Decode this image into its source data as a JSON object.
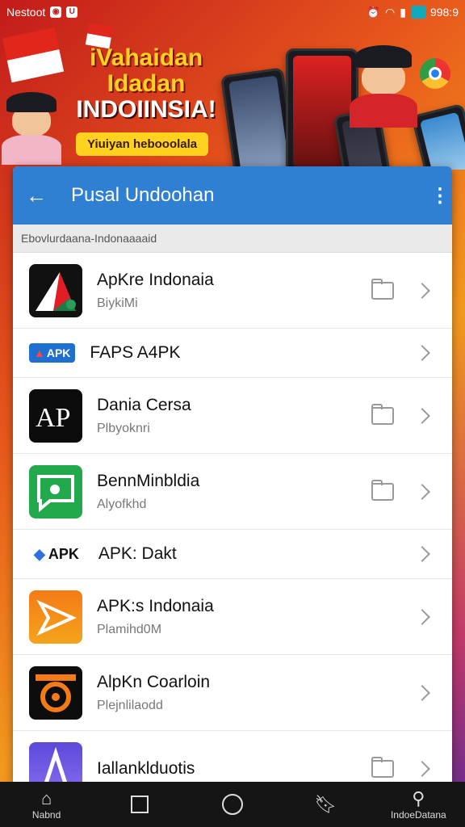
{
  "status_bar": {
    "left_text": "Nestoot",
    "time": "998:9"
  },
  "banner": {
    "headline_line1": "iVahaidan",
    "headline_line2": "Idadan",
    "headline_line3": "INDOIINSIA!",
    "cta": "Yiuiyan hebooolala"
  },
  "app_bar": {
    "title": "Pusal Undoohan"
  },
  "section_header": "Ebovlurdaana-Indonaaaaid",
  "rows": [
    {
      "name": "ApKre Indonaia",
      "sub": "BiykiMi",
      "folder": true
    },
    {
      "name": "FAPS A4PK",
      "sub": "",
      "folder": false,
      "chip": "APK"
    },
    {
      "name": "Dania Cersa",
      "sub": "Plbyoknri",
      "folder": true
    },
    {
      "name": "BennMinbldia",
      "sub": "Alyofkhd",
      "folder": true
    },
    {
      "name": "APK: Dakt",
      "sub": "",
      "folder": false,
      "chip": "APK"
    },
    {
      "name": "APK:s Indonaia",
      "sub": "Plamihd0M",
      "folder": false
    },
    {
      "name": "AlpKn Coarloin",
      "sub": "Plejnlilaodd",
      "folder": false
    },
    {
      "name": "Iallanklduotis",
      "sub": "",
      "folder": true
    }
  ],
  "nav": [
    {
      "label": "Nabnd"
    },
    {
      "label": ""
    },
    {
      "label": ""
    },
    {
      "label": ""
    },
    {
      "label": "IndoeDatana"
    }
  ]
}
